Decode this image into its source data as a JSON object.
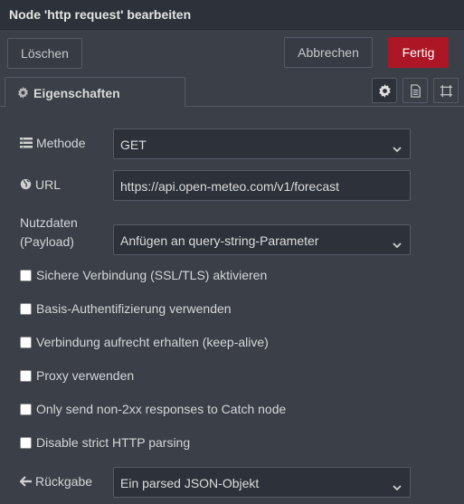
{
  "dialog": {
    "title": "Node 'http request' bearbeiten"
  },
  "buttons": {
    "delete": "Löschen",
    "cancel": "Abbrechen",
    "done": "Fertig"
  },
  "tabs": {
    "properties": "Eigenschaften"
  },
  "tab_icons": [
    "gear-icon",
    "document-icon",
    "frame-icon"
  ],
  "form": {
    "method": {
      "label": "Methode",
      "value": "GET",
      "icon": "list-icon"
    },
    "url": {
      "label": "URL",
      "value": "https://api.open-meteo.com/v1/forecast",
      "icon": "globe-icon"
    },
    "payload": {
      "label_line1": "Nutzdaten",
      "label_line2": "(Payload)",
      "value": "Anfügen an query-string-Parameter"
    },
    "checkboxes": [
      {
        "label": "Sichere Verbindung (SSL/TLS) aktivieren",
        "checked": false
      },
      {
        "label": "Basis-Authentifizierung verwenden",
        "checked": false
      },
      {
        "label": "Verbindung aufrecht erhalten (keep-alive)",
        "checked": false
      },
      {
        "label": "Proxy verwenden",
        "checked": false
      },
      {
        "label": "Only send non-2xx responses to Catch node",
        "checked": false
      },
      {
        "label": "Disable strict HTTP parsing",
        "checked": false
      }
    ],
    "return": {
      "label": "Rückgabe",
      "value": "Ein parsed JSON-Objekt",
      "icon": "arrow-left-icon"
    }
  },
  "colors": {
    "background": "#3a3f48",
    "field": "#2d3139",
    "border": "#555b66",
    "primary": "#ad1625"
  }
}
